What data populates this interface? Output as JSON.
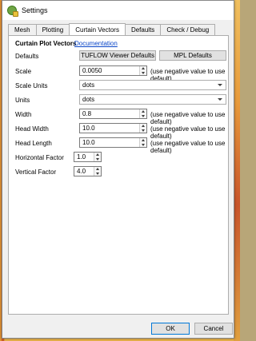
{
  "window": {
    "title": "Settings"
  },
  "tabs": [
    "Mesh",
    "Plotting",
    "Curtain Vectors",
    "Defaults",
    "Check / Debug"
  ],
  "section": {
    "heading": "Curtain Plot Vectors",
    "doc_link": "Documentation"
  },
  "defaults": {
    "label": "Defaults",
    "tuflow_button": "TUFLOW Viewer Defaults",
    "mpl_button": "MPL Defaults"
  },
  "fields": {
    "scale": {
      "label": "Scale",
      "value": "0.0050",
      "hint": "(use negative value to use default)"
    },
    "scale_units": {
      "label": "Scale Units",
      "value": "dots"
    },
    "units": {
      "label": "Units",
      "value": "dots"
    },
    "width": {
      "label": "Width",
      "value": "0.8",
      "hint": "(use negative value to use default)"
    },
    "head_width": {
      "label": "Head Width",
      "value": "10.0",
      "hint": "(use negative value to use default)"
    },
    "head_length": {
      "label": "Head Length",
      "value": "10.0",
      "hint": "(use negative value to use default)"
    },
    "horizontal_factor": {
      "label": "Horizontal Factor",
      "value": "1.0"
    },
    "vertical_factor": {
      "label": "Vertical Factor",
      "value": "4.0"
    }
  },
  "footer": {
    "ok": "OK",
    "cancel": "Cancel"
  }
}
